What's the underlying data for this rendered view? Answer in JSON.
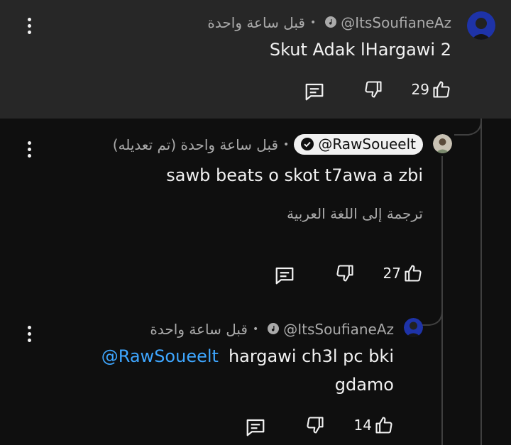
{
  "colors": {
    "background": "#0f0f0f",
    "highlight": "#272727",
    "text": "#f1f1f1",
    "secondary": "#aaaaaa",
    "link": "#3ea6ff"
  },
  "comments": [
    {
      "handle": "@ItsSoufianeAz",
      "time": "قبل ساعة واحدة",
      "badge_icon": "music-note-icon",
      "text": "Skut Adak lHargawi 2",
      "likes": "29"
    },
    {
      "handle": "@RawSoueelt",
      "time": "قبل ساعة واحدة (تم تعديله)",
      "badge_icon": "check-circle-icon",
      "text": "sawb beats o skot t7awa a zbi",
      "translate": "ترجمة إلى اللغة العربية",
      "likes": "27"
    },
    {
      "handle": "@ItsSoufianeAz",
      "time": "قبل ساعة واحدة",
      "badge_icon": "music-note-icon",
      "mention": "@RawSoueelt",
      "text_line1": "hargawi ch3l pc bki",
      "text_line2": "gdamo",
      "likes": "14"
    }
  ],
  "separator": "•"
}
